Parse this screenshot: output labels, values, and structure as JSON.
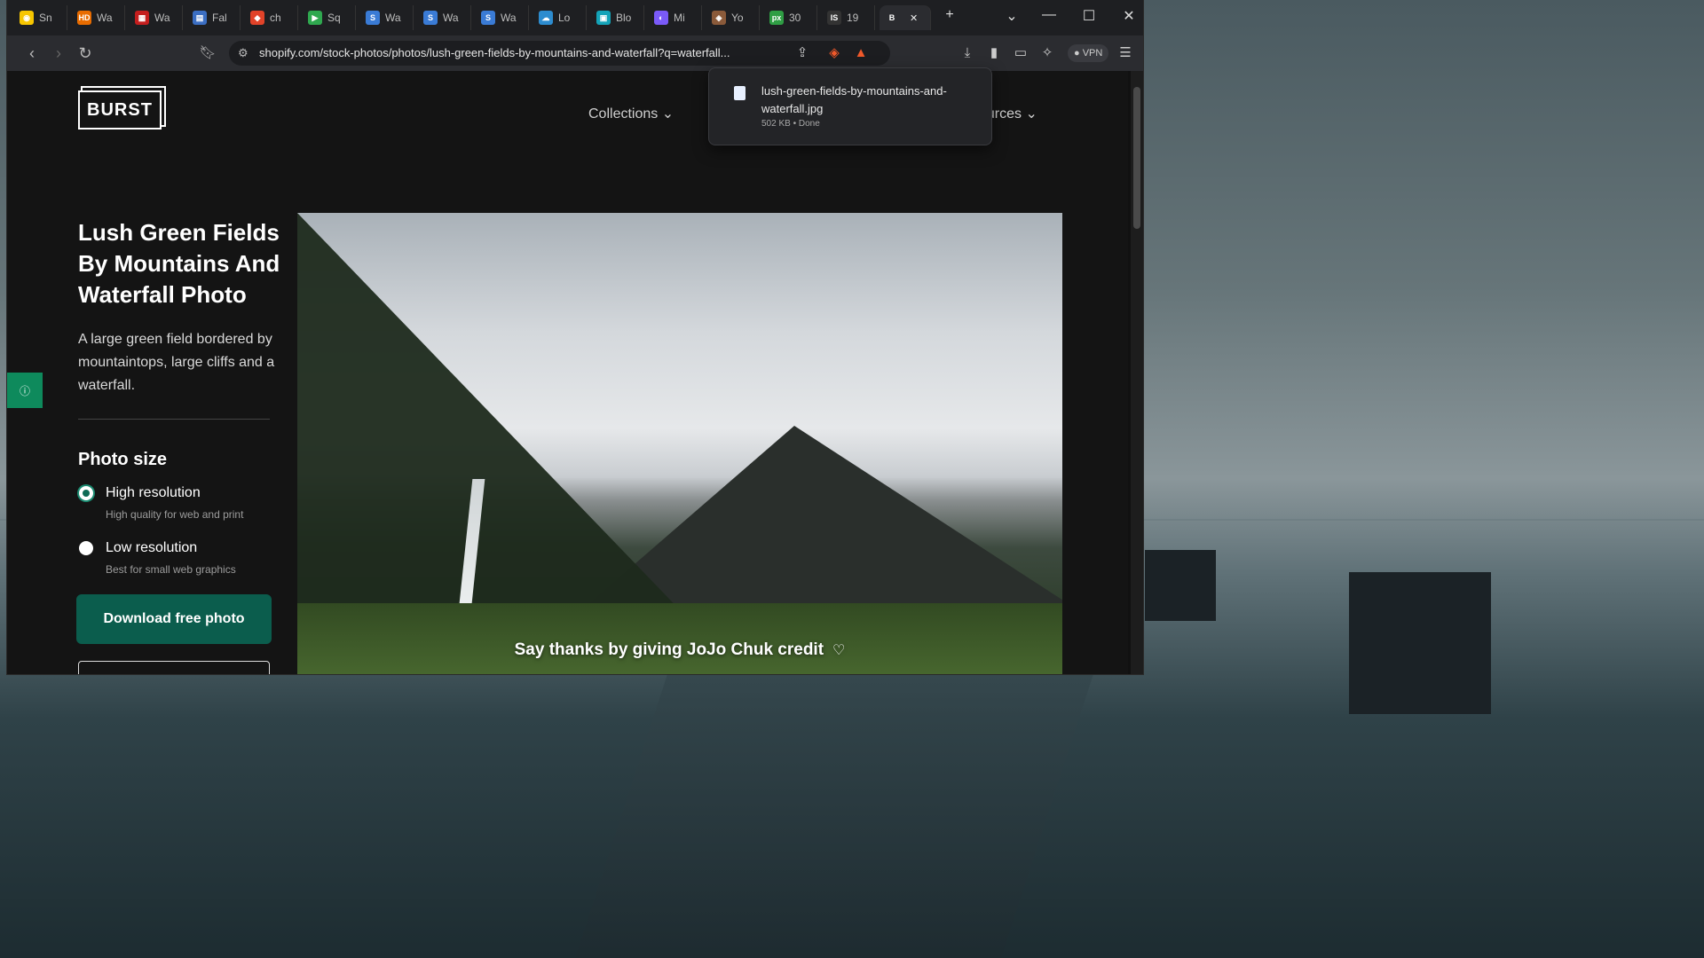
{
  "tabs": [
    {
      "label": "Sn",
      "fav_color": "#f7c600",
      "fav": "◉"
    },
    {
      "label": "Wa",
      "fav_color": "#e86c00",
      "fav": "HD"
    },
    {
      "label": "Wa",
      "fav_color": "#c41e1e",
      "fav": "▦"
    },
    {
      "label": "Fal",
      "fav_color": "#3b6ec2",
      "fav": "▤"
    },
    {
      "label": "ch",
      "fav_color": "#e24329",
      "fav": "◆"
    },
    {
      "label": "Sq",
      "fav_color": "#2fa84f",
      "fav": "▶"
    },
    {
      "label": "Wa",
      "fav_color": "#3a7bd5",
      "fav": "S"
    },
    {
      "label": "Wa",
      "fav_color": "#3a7bd5",
      "fav": "S"
    },
    {
      "label": "Wa",
      "fav_color": "#3a7bd5",
      "fav": "S"
    },
    {
      "label": "Lo",
      "fav_color": "#2d8ccf",
      "fav": "☁"
    },
    {
      "label": "Blo",
      "fav_color": "#14a3b8",
      "fav": "▣"
    },
    {
      "label": "Mi",
      "fav_color": "#7a5af8",
      "fav": "◐"
    },
    {
      "label": "Yo",
      "fav_color": "#8a5a3a",
      "fav": "◈"
    },
    {
      "label": "30",
      "fav_color": "#2f9e44",
      "fav": "px"
    },
    {
      "label": "19",
      "fav_color": "#333333",
      "fav": "IS"
    },
    {
      "label": "",
      "fav_color": "#ffffff",
      "fav": "B",
      "active": true
    }
  ],
  "window": {
    "new_tab": "+",
    "tab_list": "⌄",
    "minimize": "—",
    "maximize": "☐",
    "close": "✕",
    "tab_close": "✕"
  },
  "addressbar": {
    "url": "shopify.com/stock-photos/photos/lush-green-fields-by-mountains-and-waterfall?q=waterfall...",
    "vpn_label": "VPN"
  },
  "site": {
    "logo": "BURST",
    "nav": {
      "collections": "Collections ⌄",
      "resources": "ources ⌄"
    }
  },
  "photo_page": {
    "title": "Lush Green Fields By Mountains And Waterfall Photo",
    "description": "A large green field bordered by mountaintops, large cliffs and a waterfall.",
    "size_heading": "Photo size",
    "options": [
      {
        "label": "High resolution",
        "sub": "High quality for web and print",
        "selected": true
      },
      {
        "label": "Low resolution",
        "sub": "Best for small web graphics",
        "selected": false
      }
    ],
    "download_label": "Download free photo",
    "credit": "Say thanks by giving JoJo Chuk credit",
    "credit_heart": "♡"
  },
  "download_popup": {
    "filename": "lush-green-fields-by-mountains-and-waterfall.jpg",
    "status": "502 KB • Done"
  },
  "colors": {
    "accent_green": "#0b5d4d",
    "feedback_green": "#0e8a5c"
  }
}
